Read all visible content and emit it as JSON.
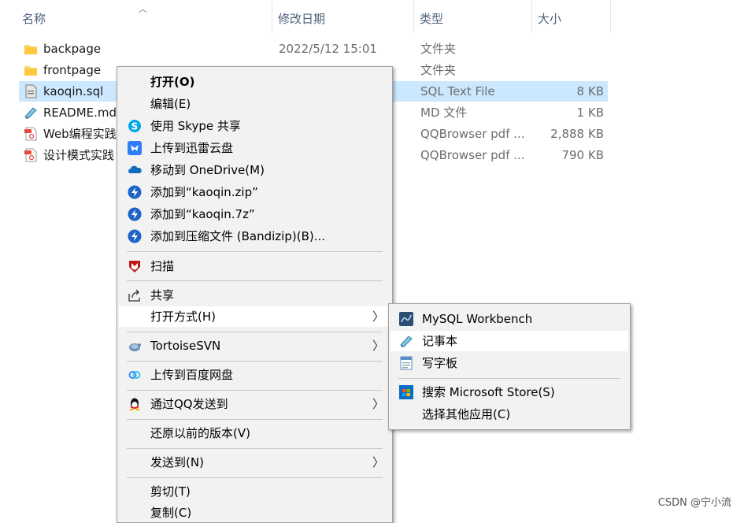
{
  "columns": {
    "name": "名称",
    "date": "修改日期",
    "type": "类型",
    "size": "大小"
  },
  "files": [
    {
      "name": "backpage",
      "date": "2022/5/12 15:01",
      "type": "文件夹",
      "size": "",
      "icon": "folder-icon"
    },
    {
      "name": "frontpage",
      "date": "",
      "type": "文件夹",
      "size": "",
      "icon": "folder-icon"
    },
    {
      "name": "kaoqin.sql",
      "date": "",
      "type": "SQL Text File",
      "size": "8 KB",
      "icon": "sql-file-icon"
    },
    {
      "name": "README.md",
      "date": "",
      "type": "MD 文件",
      "size": "1 KB",
      "icon": "notepad-icon"
    },
    {
      "name": "Web编程实践",
      "date": "",
      "type": "QQBrowser pdf ...",
      "size": "2,888 KB",
      "icon": "pdf-icon"
    },
    {
      "name": "设计模式实践",
      "date": "",
      "type": "QQBrowser pdf ...",
      "size": "790 KB",
      "icon": "pdf-icon"
    }
  ],
  "context_menu": {
    "items": [
      {
        "label": "打开(O)",
        "icon": "",
        "bold": true
      },
      {
        "label": "编辑(E)",
        "icon": ""
      },
      {
        "label": "使用 Skype 共享",
        "icon": "skype-icon"
      },
      {
        "label": "上传到迅雷云盘",
        "icon": "xunlei-icon"
      },
      {
        "label": "移动到 OneDrive(M)",
        "icon": "onedrive-icon"
      },
      {
        "label": "添加到“kaoqin.zip”",
        "icon": "bandizip-icon"
      },
      {
        "label": "添加到“kaoqin.7z”",
        "icon": "bandizip-icon"
      },
      {
        "label": "添加到压缩文件 (Bandizip)(B)...",
        "icon": "bandizip-icon"
      },
      {
        "label": "扫描",
        "icon": "mcafee-icon"
      },
      {
        "label": "共享",
        "icon": "share-icon"
      },
      {
        "label": "打开方式(H)",
        "icon": "",
        "submenu": true,
        "highlighted": true
      },
      {
        "label": "TortoiseSVN",
        "icon": "tortoisesvn-icon",
        "submenu": true
      },
      {
        "label": "上传到百度网盘",
        "icon": "baidu-netdisk-icon"
      },
      {
        "label": "通过QQ发送到",
        "icon": "qq-icon",
        "submenu": true
      },
      {
        "label": "还原以前的版本(V)",
        "icon": ""
      },
      {
        "label": "发送到(N)",
        "icon": "",
        "submenu": true
      },
      {
        "label": "剪切(T)",
        "icon": ""
      },
      {
        "label": "复制(C)",
        "icon": ""
      }
    ]
  },
  "open_with_menu": {
    "items": [
      {
        "label": "MySQL Workbench",
        "icon": "mysql-workbench-icon"
      },
      {
        "label": "记事本",
        "icon": "notepad-icon",
        "highlighted": true
      },
      {
        "label": "写字板",
        "icon": "wordpad-icon"
      },
      {
        "label": "搜索 Microsoft Store(S)",
        "icon": "microsoft-store-icon"
      },
      {
        "label": "选择其他应用(C)",
        "icon": ""
      }
    ]
  },
  "watermark": "CSDN @宁小流",
  "colors": {
    "selection": "#cce8ff",
    "menu_bg": "#f2f2f2",
    "menu_highlight": "#ffffff"
  }
}
